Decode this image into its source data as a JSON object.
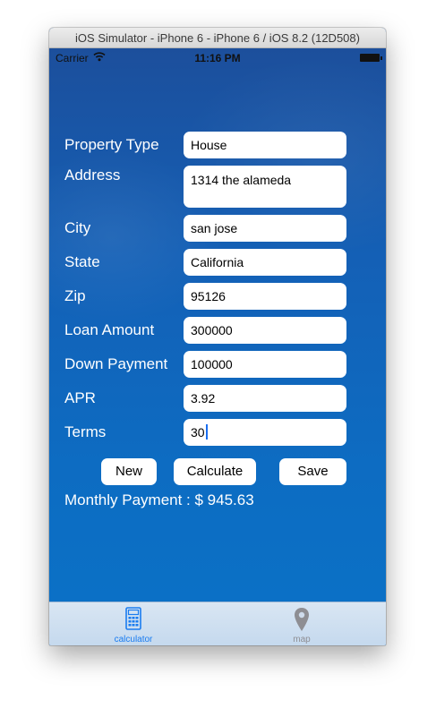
{
  "window": {
    "title": "iOS Simulator - iPhone 6 - iPhone 6 / iOS 8.2 (12D508)"
  },
  "status_bar": {
    "carrier": "Carrier",
    "time": "11:16 PM"
  },
  "form": {
    "property_type": {
      "label": "Property Type",
      "value": "House"
    },
    "address": {
      "label": "Address",
      "value": "1314 the alameda"
    },
    "city": {
      "label": "City",
      "value": "san jose"
    },
    "state": {
      "label": "State",
      "value": "California"
    },
    "zip": {
      "label": "Zip",
      "value": "95126"
    },
    "loan_amount": {
      "label": "Loan Amount",
      "value": "300000"
    },
    "down_payment": {
      "label": "Down Payment",
      "value": "100000"
    },
    "apr": {
      "label": "APR",
      "value": "3.92"
    },
    "terms": {
      "label": "Terms",
      "value": "30"
    }
  },
  "buttons": {
    "new_label": "New",
    "calculate_label": "Calculate",
    "save_label": "Save"
  },
  "result": {
    "monthly_payment": "Monthly Payment : $ 945.63"
  },
  "tab_bar": {
    "tabs": [
      {
        "label": "calculator",
        "icon": "calculator-icon",
        "selected": true,
        "color": "#1a7cf0"
      },
      {
        "label": "map",
        "icon": "map-pin-icon",
        "selected": false,
        "color": "#8e8e93"
      }
    ]
  }
}
